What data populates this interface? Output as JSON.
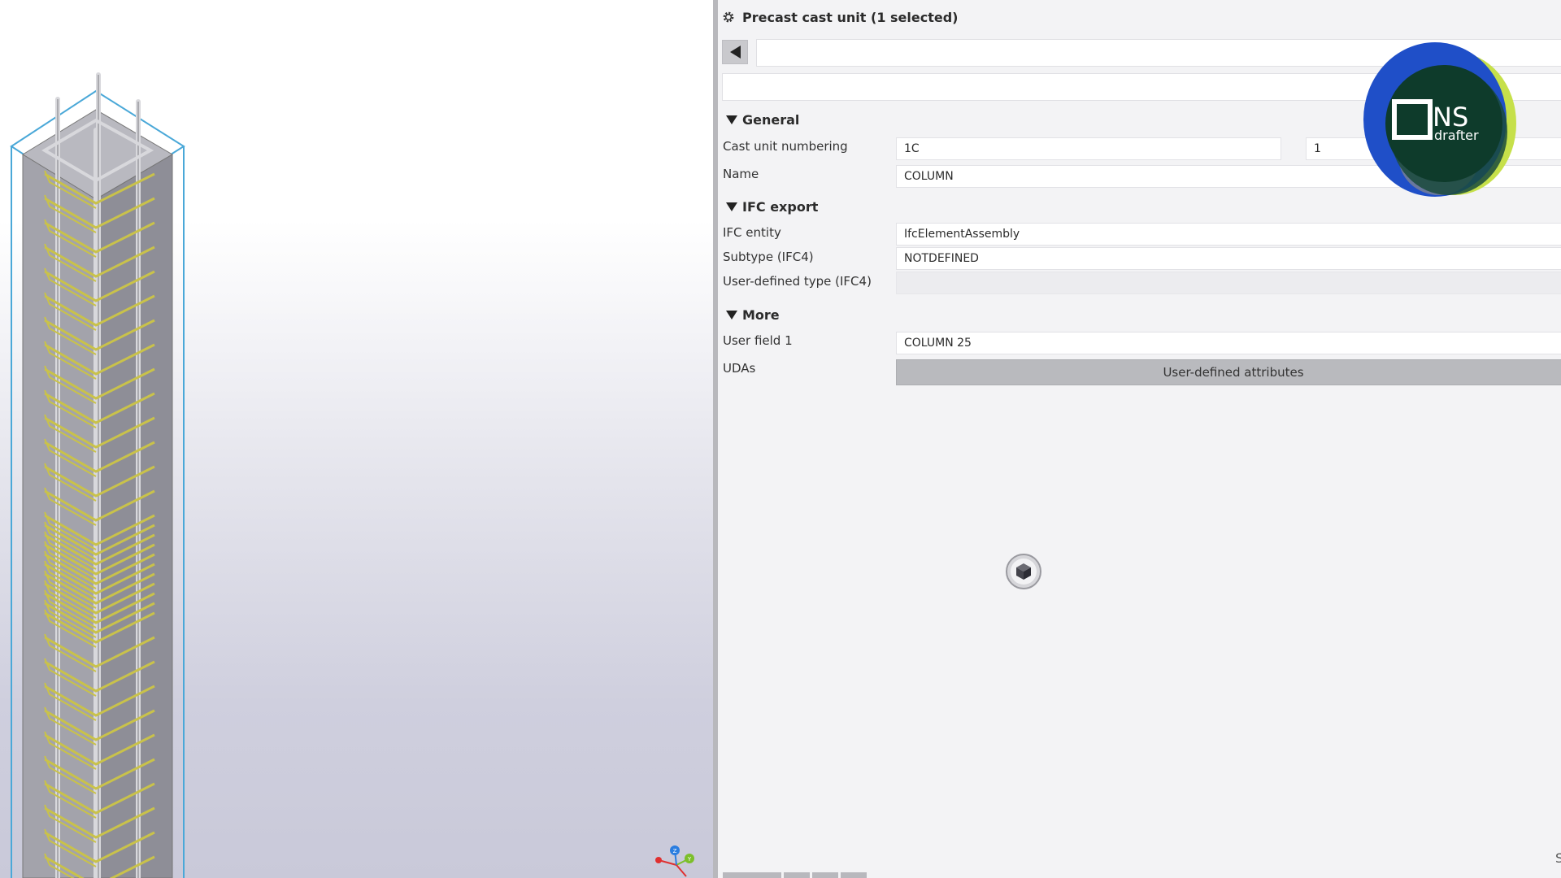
{
  "panel": {
    "title": "Precast cast unit (1 selected)",
    "sections": {
      "general": "General",
      "ifc_export": "IFC export",
      "more": "More"
    },
    "fields": {
      "cast_unit_numbering_label": "Cast unit numbering",
      "cast_unit_prefix": "1C",
      "cast_unit_start": "1",
      "name_label": "Name",
      "name_value": "COLUMN",
      "ifc_entity_label": "IFC entity",
      "ifc_entity_value": "IfcElementAssembly",
      "subtype_label": "Subtype (IFC4)",
      "subtype_value": "NOTDEFINED",
      "user_defined_type_label": "User-defined type (IFC4)",
      "user_defined_type_value": "",
      "user_field_1_label": "User field 1",
      "user_field_1_value": "COLUMN 25",
      "udas_label": "UDAs",
      "udas_button": "User-defined attributes"
    },
    "corner_char": "S"
  },
  "logo": {
    "text_main": "NS",
    "text_sub": "drafter",
    "colors": {
      "blue": "#1f4fc8",
      "green": "#c6e04a",
      "dark": "#0e3b2b"
    }
  },
  "viewport": {
    "axis": {
      "x": "X",
      "y": "Y",
      "z": "Z"
    },
    "colors": {
      "rebar": "#c9c24a",
      "concrete": "#9c9ca3",
      "bbox": "#4aa8d8"
    }
  }
}
